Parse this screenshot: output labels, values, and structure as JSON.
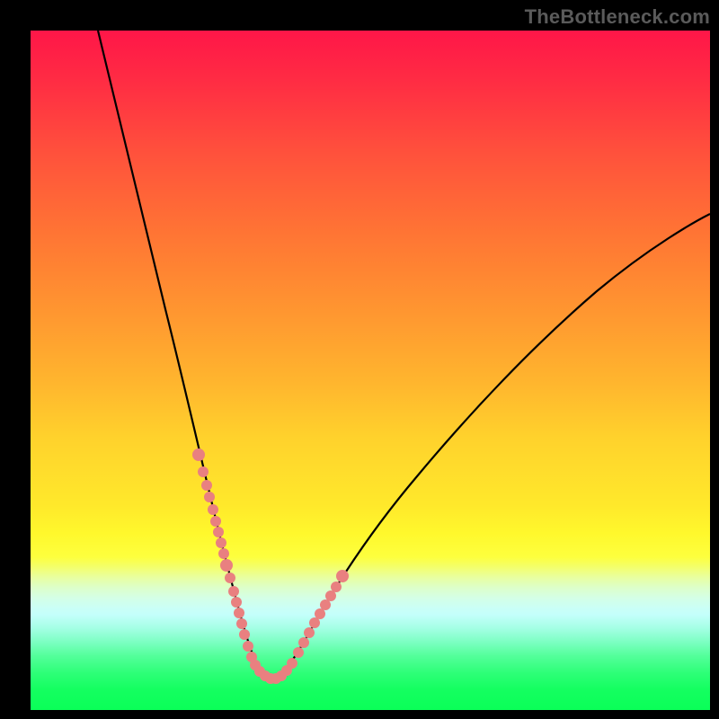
{
  "watermark": "TheBottleneck.com",
  "chart_data": {
    "type": "line",
    "title": "",
    "xlabel": "",
    "ylabel": "",
    "xlim": [
      0,
      100
    ],
    "ylim": [
      0,
      100
    ],
    "series": [
      {
        "name": "bottleneck-curve",
        "color": "#000000",
        "x": [
          10,
          12,
          14,
          16,
          18,
          20,
          22,
          24,
          26,
          28,
          30,
          31,
          32,
          33,
          34,
          35,
          36,
          38,
          40,
          44,
          48,
          52,
          56,
          60,
          64,
          68,
          72,
          76,
          80,
          84,
          88,
          92,
          96,
          100
        ],
        "y": [
          100,
          90,
          80,
          71,
          62,
          54,
          46,
          39,
          32,
          26,
          20,
          17,
          14,
          11,
          8,
          6,
          5,
          5,
          7,
          12,
          17,
          22,
          27,
          32,
          37,
          42,
          46,
          50,
          54,
          58,
          62,
          66,
          69.5,
          73
        ]
      },
      {
        "name": "highlight-markers",
        "color": "#e98080",
        "type": "scatter",
        "x": [
          24.5,
          25.5,
          26,
          26.5,
          27,
          27.5,
          28,
          28.5,
          29,
          29.5,
          30,
          30.5,
          31,
          31.5,
          32,
          32.5,
          33,
          33.5,
          34,
          34.5,
          35,
          35.5,
          36,
          36.5,
          37,
          37.5,
          38,
          39,
          40,
          41,
          42,
          43,
          44,
          45,
          46
        ],
        "y": [
          38,
          35,
          33,
          31.5,
          30,
          28,
          26,
          24,
          22,
          20,
          19,
          17.5,
          15,
          13.5,
          12,
          10.5,
          9,
          8,
          7,
          6.5,
          6,
          5.5,
          5,
          5,
          5.5,
          6,
          6.5,
          7.5,
          9,
          10.5,
          12,
          13.5,
          15,
          17,
          19
        ]
      }
    ],
    "bands": [
      {
        "name": "red",
        "from": 70,
        "to": 100
      },
      {
        "name": "orange",
        "from": 40,
        "to": 70
      },
      {
        "name": "yellow",
        "from": 18,
        "to": 40
      },
      {
        "name": "green",
        "from": 0,
        "to": 18
      }
    ]
  }
}
